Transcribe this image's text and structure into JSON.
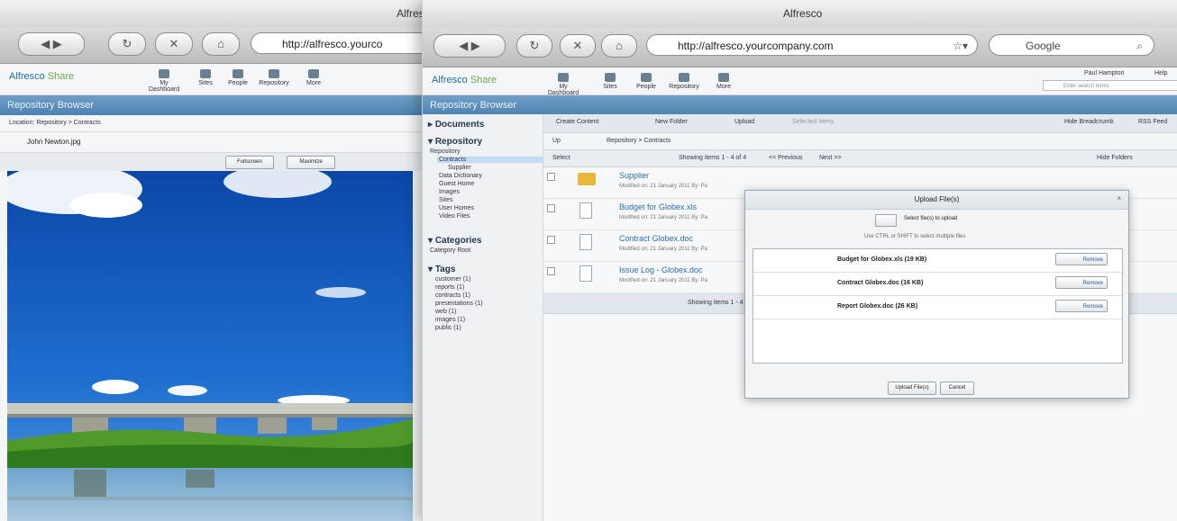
{
  "background_window": {
    "title": "Alfresc",
    "url": "http://alfresco.yourco",
    "logo_text": "Alfresco",
    "logo_share": "Share",
    "nav": [
      "My Dashboard",
      "Sites",
      "People",
      "Repository",
      "More"
    ],
    "banner": "Repository Browser",
    "breadcrumb": "Location: Repository > Contracts",
    "file_name": "John Newton.jpg",
    "viewer_controls": [
      "Fullscreen",
      "Maximize"
    ]
  },
  "window": {
    "title": "Alfresco",
    "url": "http://alfresco.yourcompany.com",
    "search_placeholder": "Google",
    "user": "Paul Hampton",
    "help": "Help",
    "search_hint": "Enter search terms"
  },
  "share": {
    "logo_text": "Alfresco",
    "logo_share": "Share",
    "nav": [
      "My Dashboard",
      "Sites",
      "People",
      "Repository",
      "More"
    ],
    "banner": "Repository Browser"
  },
  "left_panel": {
    "documents_heading": "Documents",
    "repository_heading": "Repository",
    "tree": [
      "Repository",
      "Contracts",
      "Supplier",
      "Data Dictionary",
      "Guest Home",
      "Images",
      "Sites",
      "User Homes",
      "Video Files"
    ],
    "categories_heading": "Categories",
    "category_root": "Category Root",
    "tags_heading": "Tags",
    "tags": [
      "customer (1)",
      "reports (1)",
      "contracts (1)",
      "presentations (1)",
      "web (1)",
      "images (1)",
      "public (1)"
    ]
  },
  "toolbar": {
    "create_content": "Create Content",
    "new_folder": "New Folder",
    "upload": "Upload",
    "selected_items": "Selected Items",
    "hide_breadcrumb": "Hide Breadcrumb",
    "rss_feed": "RSS Feed",
    "up": "Up",
    "breadcrumb": "Repository > Contracts",
    "select": "Select",
    "showing": "Showing items 1 - 4 of 4",
    "previous": "<< Previous",
    "next": "Next >>",
    "hide_folders": "Hide Folders"
  },
  "documents": [
    {
      "name": "Supplier",
      "meta": "Modified on: 21 January 2011 By: Pa"
    },
    {
      "name": "Budget for Globex.xls",
      "meta": "Modified on: 21 January 2011 By: Pa"
    },
    {
      "name": "Contract Globex.doc",
      "meta": "Modified on: 21 January 2011 By: Pa"
    },
    {
      "name": "Issue Log - Globex.doc",
      "meta": "Modified on: 21 January 2011 By: Pa"
    }
  ],
  "footer_showing": "Showing items 1 - 4 of 4",
  "dialog": {
    "title": "Upload File(s)",
    "select_files": "Select file(s) to upload",
    "hint": "Use CTRL or SHIFT to select multiple files",
    "files": [
      {
        "name": "Budget for Globex.xls (19 KB)",
        "action": "Remove"
      },
      {
        "name": "Contract Globex.doc (16 KB)",
        "action": "Remove"
      },
      {
        "name": "Report Globex.doc (26 KB)",
        "action": "Remove"
      }
    ],
    "upload_button": "Upload File(s)",
    "cancel_button": "Cancel"
  }
}
